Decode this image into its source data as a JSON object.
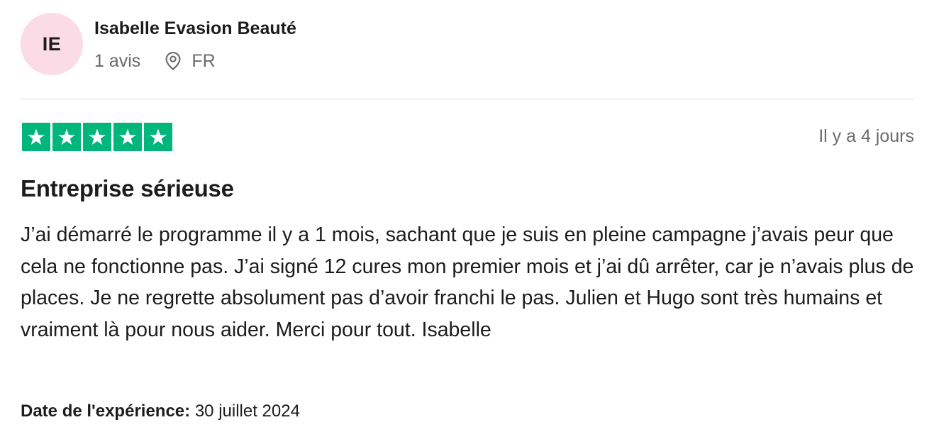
{
  "reviewer": {
    "initials": "IE",
    "name": "Isabelle Evasion Beauté",
    "review_count": "1 avis",
    "location_icon": "map-pin-icon",
    "country": "FR",
    "avatar_color": "#fbdbe6"
  },
  "review": {
    "rating": 5,
    "rating_max": 5,
    "star_color": "#00b67a",
    "date": "Il y a 4 jours",
    "title": "Entreprise sérieuse",
    "text": "J’ai démarré le programme il y a 1 mois, sachant que je suis en pleine campagne j’avais peur que cela ne fonctionne pas. J’ai signé 12 cures mon premier mois et j’ai dû arrêter, car je n’avais plus de places. Je ne regrette absolument pas d’avoir franchi le pas. Julien et Hugo sont très humains et vraiment là pour nous aider. Merci pour tout. Isabelle",
    "experience_label": "Date de l'expérience:",
    "experience_date": "30 juillet 2024"
  }
}
